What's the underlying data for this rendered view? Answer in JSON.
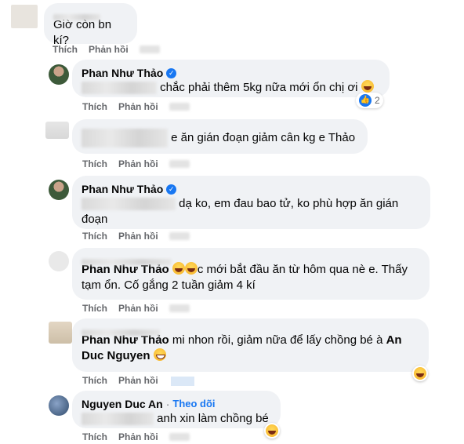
{
  "labels": {
    "like": "Thích",
    "reply": "Phản hồi",
    "follow": "Theo dõi",
    "dot": "·"
  },
  "comments": [
    {
      "text": "Giờ còn bn kí?"
    },
    {
      "author": "Phan Như Thảo",
      "text": "chắc phải thêm 5kg nữa mới ổn chị ơi",
      "reaction_count": "2"
    },
    {
      "text": "e ăn gián đoạn giảm cân kg e Thảo"
    },
    {
      "author": "Phan Như Thảo",
      "text_line1": "dạ ko, em đau bao tử, ko phù hợp ăn gián",
      "text_line2": "đoạn"
    },
    {
      "tag": "Phan Như Thảo",
      "text_line1": "c mới bắt đầu ăn từ hôm qua nè e. Thấy",
      "text_line2": "tạm ổn. Cố gắng 2 tuần giảm 4 kí"
    },
    {
      "tag": "Phan Như Thảo",
      "text_line1": "mi nhon rồi, giảm nữa để lấy chồng bé à",
      "tag2_line1": "An",
      "tag2_line2": "Duc Nguyen"
    },
    {
      "author": "Nguyen Duc An",
      "text": "anh xin làm chồng bé"
    }
  ],
  "colors": {
    "bubble": "#f0f2f5",
    "action": "#65676b",
    "link": "#1877f2"
  }
}
